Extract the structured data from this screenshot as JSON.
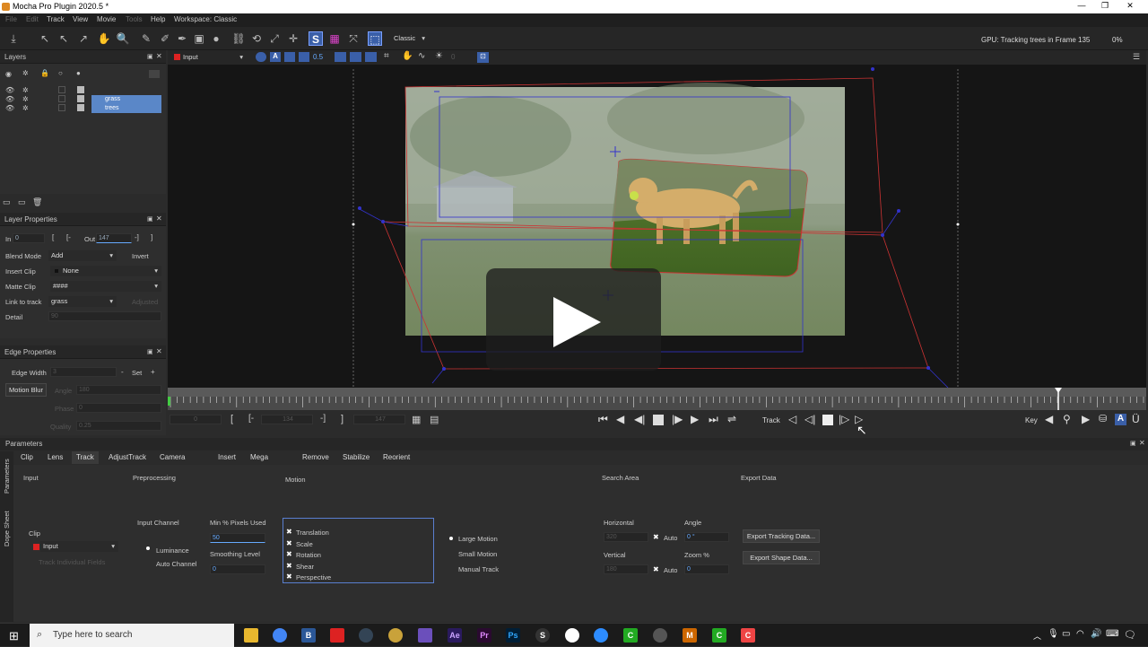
{
  "window": {
    "title": "Mocha Pro Plugin 2020.5 *"
  },
  "menu": [
    "File",
    "Edit",
    "Track",
    "View",
    "Movie",
    "Tools",
    "Help",
    "Workspace: Classic"
  ],
  "toolbar": {
    "workspace_select": "Classic",
    "status": "GPU: Tracking trees in Frame 135",
    "percent": "0%"
  },
  "layers": {
    "title": "Layers",
    "items": [
      {
        "name": ""
      },
      {
        "name": "grass"
      },
      {
        "name": "trees"
      }
    ]
  },
  "layer_properties": {
    "title": "Layer Properties",
    "in_label": "In",
    "in_value": "0",
    "out_label": "Out",
    "out_value": "147",
    "blend_mode_label": "Blend Mode",
    "blend_mode": "Add",
    "invert": "Invert",
    "insert_clip_label": "Insert Clip",
    "insert_clip": "None",
    "matte_clip_label": "Matte Clip",
    "matte_clip": "####",
    "link_label": "Link to track",
    "link_value": "grass",
    "adjusted": "Adjusted",
    "detail_label": "Detail",
    "detail_value": "90"
  },
  "edge_properties": {
    "title": "Edge Properties",
    "edge_width_label": "Edge Width",
    "edge_width": "3",
    "set": "Set",
    "motion_blur": "Motion Blur",
    "angle_label": "Angle",
    "angle": "180",
    "phase_label": "Phase",
    "phase": "0",
    "quality_label": "Quality",
    "quality": "0.25"
  },
  "viewer": {
    "clip": "Input",
    "opacity": "0.5",
    "frame": "0"
  },
  "transport": {
    "in_frame": "0",
    "mid_frame": "134",
    "out_frame": "147",
    "track_label": "Track",
    "key_label": "Key"
  },
  "params": {
    "title": "Parameters",
    "tabs": [
      "Clip",
      "Lens",
      "Track",
      "AdjustTrack",
      "Camera Solve",
      "Insert",
      "Mega Plates",
      "Remove",
      "Stabilize",
      "Reorient"
    ],
    "sections": {
      "input": "Input",
      "preprocessing": "Preprocessing",
      "motion": "Motion",
      "search_area": "Search Area",
      "export_data": "Export Data"
    },
    "clip_label": "Clip",
    "clip_value": "Input",
    "track_individual": "Track Individual Fields",
    "input_channel": "Input Channel",
    "luminance": "Luminance",
    "auto_channel": "Auto Channel",
    "min_pixels": "Min % Pixels Used",
    "min_pixels_value": "50",
    "smoothing": "Smoothing Level",
    "smoothing_value": "0",
    "motion_items": [
      "Translation",
      "Scale",
      "Rotation",
      "Shear",
      "Perspective"
    ],
    "large_motion": "Large Motion",
    "small_motion": "Small Motion",
    "manual_track": "Manual Track",
    "horizontal": "Horizontal",
    "horizontal_value": "320",
    "vertical": "Vertical",
    "vertical_value": "180",
    "auto": "Auto",
    "angle": "Angle",
    "angle_value": "0 °",
    "zoom": "Zoom %",
    "zoom_value": "0",
    "export_tracking": "Export Tracking Data...",
    "export_shape": "Export Shape Data..."
  },
  "sidetabs": [
    "Parameters",
    "Dope Sheet"
  ],
  "taskbar": {
    "search": "Type here to search"
  }
}
